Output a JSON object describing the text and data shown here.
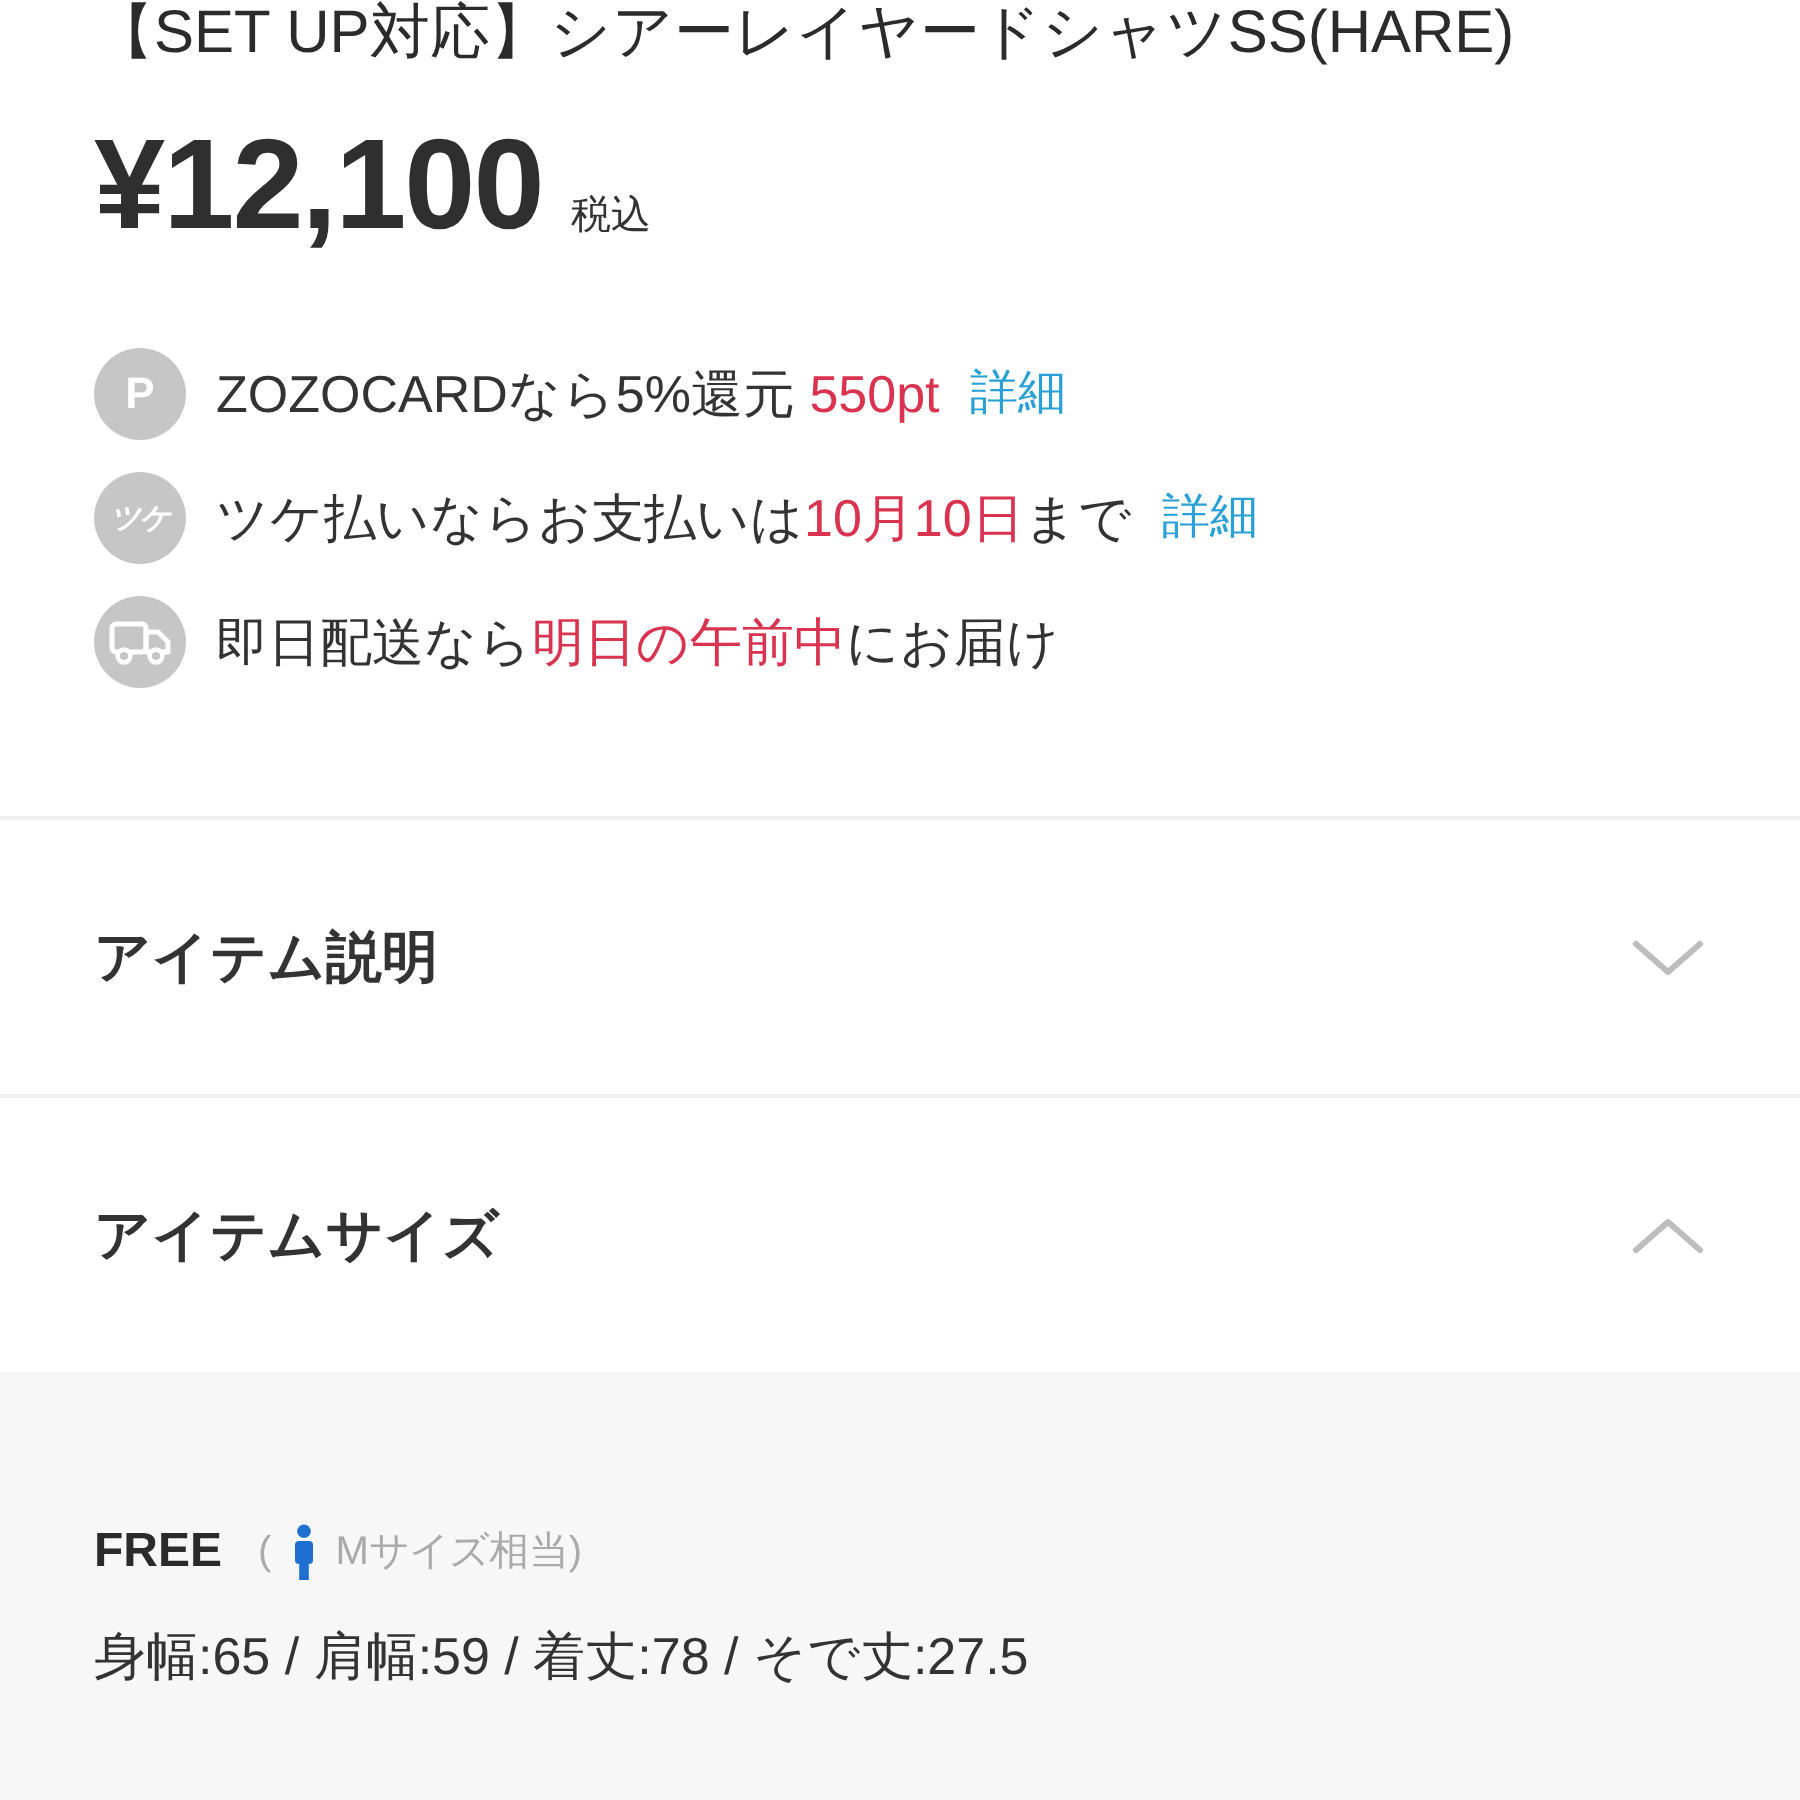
{
  "product": {
    "title": "【SET UP対応】シアーレイヤードシャツSS(HARE)",
    "price": "¥12,100",
    "tax_note": "税込"
  },
  "benefits": [
    {
      "kind": "points",
      "badge": "P",
      "segments": [
        {
          "text": "ZOZOCARDなら5%還元 ",
          "highlight": false
        },
        {
          "text": "550pt",
          "highlight": true
        }
      ],
      "link": "詳細"
    },
    {
      "kind": "deferred",
      "badge": "ツケ",
      "segments": [
        {
          "text": "ツケ払いならお支払いは",
          "highlight": false
        },
        {
          "text": "10月10日",
          "highlight": true
        },
        {
          "text": "まで",
          "highlight": false
        }
      ],
      "link": "詳細"
    },
    {
      "kind": "delivery",
      "segments": [
        {
          "text": "即日配送なら",
          "highlight": false
        },
        {
          "text": "明日の午前中",
          "highlight": true
        },
        {
          "text": "にお届け",
          "highlight": false
        }
      ]
    }
  ],
  "sections": [
    {
      "title": "アイテム説明",
      "expanded": false
    },
    {
      "title": "アイテムサイズ",
      "expanded": true,
      "sizes": [
        {
          "name": "FREE",
          "equivalent_open": "(",
          "equivalent": "Mサイズ相当)",
          "measurements": "身幅:65 / 肩幅:59 / 着丈:78 / そで丈:27.5"
        }
      ]
    }
  ]
}
